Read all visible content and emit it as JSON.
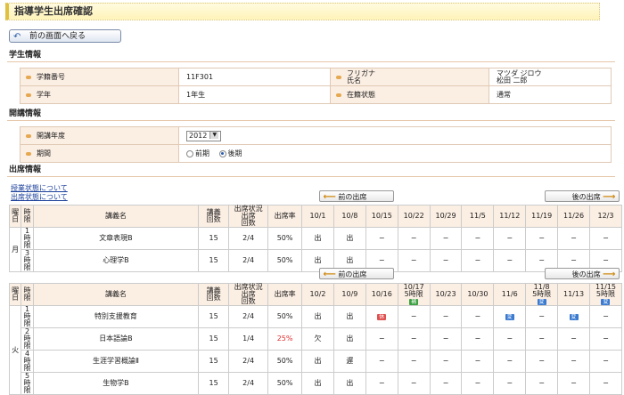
{
  "page_title": "指導学生出席確認",
  "back_button": "前の画面へ戻る",
  "student_section": {
    "heading": "学生情報",
    "student_id_label": "学籍番号",
    "student_id": "11F301",
    "kana_label": "フリガナ",
    "name_label": "氏名",
    "kana": "マツダ ジロウ",
    "name": "松田 二郎",
    "year_label": "学年",
    "year": "1年生",
    "status_label": "在籍状態",
    "status": "通常"
  },
  "course_section": {
    "heading": "開講情報",
    "year_label": "開講年度",
    "year_value": "2012",
    "term_label": "期間",
    "term_options": [
      "前期",
      "後期"
    ],
    "term_selected": "後期"
  },
  "attendance_section": {
    "heading": "出席情報",
    "links": [
      "授業状態について",
      "出席状態について"
    ],
    "prev_label": "前の出席",
    "next_label": "後の出席"
  },
  "table1": {
    "headers": {
      "day": [
        "曜",
        "日"
      ],
      "period": [
        "時",
        "限"
      ],
      "course": "講義名",
      "lectures": [
        "講義",
        "回数"
      ],
      "status": [
        "出席状況",
        "出席",
        "回数"
      ],
      "rate": "出席率"
    },
    "dates": [
      "10/1",
      "10/8",
      "10/15",
      "10/22",
      "10/29",
      "11/5",
      "11/12",
      "11/19",
      "11/26",
      "12/3"
    ],
    "day": "月",
    "rows": [
      {
        "period": [
          "1",
          "時",
          "限"
        ],
        "course": "文章表現B",
        "lectures": "15",
        "attended": "2/4",
        "rate": "50%",
        "cells": [
          "出",
          "出",
          "−",
          "−",
          "−",
          "−",
          "−",
          "−",
          "−",
          "−"
        ]
      },
      {
        "period": [
          "3",
          "時",
          "限"
        ],
        "course": "心理学B",
        "lectures": "15",
        "attended": "2/4",
        "rate": "50%",
        "cells": [
          "出",
          "出",
          "−",
          "−",
          "−",
          "−",
          "−",
          "−",
          "−",
          "−"
        ]
      }
    ]
  },
  "table2": {
    "dates": [
      {
        "d": "10/2",
        "sub": ""
      },
      {
        "d": "10/9",
        "sub": ""
      },
      {
        "d": "10/16",
        "sub": ""
      },
      {
        "d": "10/17",
        "sub": "5時限",
        "badge": "補",
        "bc": "b-grn"
      },
      {
        "d": "10/23",
        "sub": ""
      },
      {
        "d": "10/30",
        "sub": ""
      },
      {
        "d": "11/6",
        "sub": ""
      },
      {
        "d": "11/8",
        "sub": "5時限",
        "badge": "変",
        "bc": "b-blu"
      },
      {
        "d": "11/13",
        "sub": ""
      },
      {
        "d": "11/15",
        "sub": "5時限",
        "badge": "変",
        "bc": "b-blu"
      }
    ],
    "day": "火",
    "rows": [
      {
        "period": [
          "1",
          "時",
          "限"
        ],
        "course": "特別支援教育",
        "lectures": "15",
        "attended": "2/4",
        "rate": "50%",
        "rate_red": false,
        "cells": [
          {
            "t": "出"
          },
          {
            "t": "出"
          },
          {
            "badge": "休",
            "bc": "b-red"
          },
          {
            "t": "−"
          },
          {
            "t": "−"
          },
          {
            "t": "−"
          },
          {
            "badge": "変",
            "bc": "b-blu"
          },
          {
            "t": "−"
          },
          {
            "badge": "変",
            "bc": "b-blu"
          },
          {
            "t": "−"
          }
        ]
      },
      {
        "period": [
          "2",
          "時",
          "限"
        ],
        "course": "日本語論B",
        "lectures": "15",
        "attended": "1/4",
        "rate": "25%",
        "rate_red": true,
        "cells": [
          {
            "t": "欠"
          },
          {
            "t": "出"
          },
          {
            "t": "−"
          },
          {
            "t": "−"
          },
          {
            "t": "−"
          },
          {
            "t": "−"
          },
          {
            "t": "−"
          },
          {
            "t": "−"
          },
          {
            "t": "−"
          },
          {
            "t": "−"
          }
        ]
      },
      {
        "period": [
          "4",
          "時",
          "限"
        ],
        "course": "生涯学習概論Ⅱ",
        "lectures": "15",
        "attended": "2/4",
        "rate": "50%",
        "rate_red": false,
        "cells": [
          {
            "t": "出"
          },
          {
            "t": "遅"
          },
          {
            "t": "−"
          },
          {
            "t": "−"
          },
          {
            "t": "−"
          },
          {
            "t": "−"
          },
          {
            "t": "−"
          },
          {
            "t": "−"
          },
          {
            "t": "−"
          },
          {
            "t": "−"
          }
        ]
      },
      {
        "period": [
          "5",
          "時",
          "限"
        ],
        "course": "生物学B",
        "lectures": "15",
        "attended": "2/4",
        "rate": "50%",
        "rate_red": false,
        "cells": [
          {
            "t": "出"
          },
          {
            "t": "出"
          },
          {
            "t": "−"
          },
          {
            "t": "−"
          },
          {
            "t": "−"
          },
          {
            "t": "−"
          },
          {
            "t": "−"
          },
          {
            "t": "−"
          },
          {
            "t": "−"
          },
          {
            "t": "−"
          }
        ]
      }
    ]
  }
}
